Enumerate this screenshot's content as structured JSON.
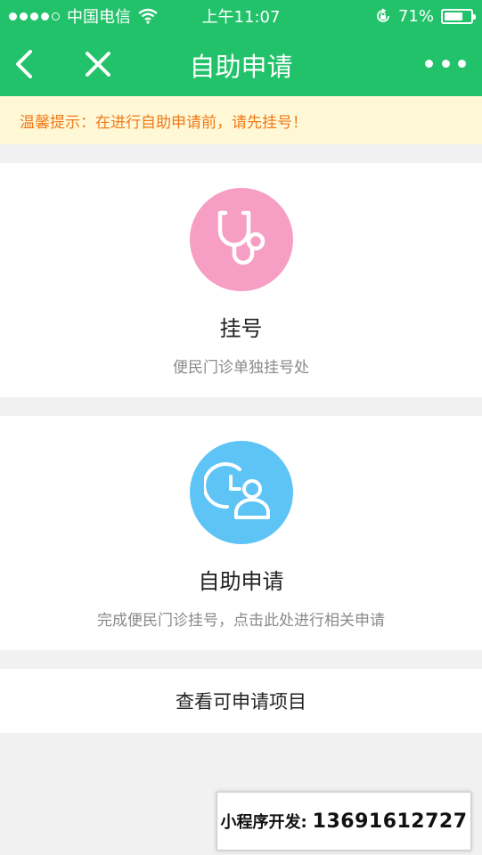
{
  "status_bar": {
    "carrier": "中国电信",
    "time": "上午11:07",
    "battery_percent": "71%",
    "battery_level": 0.71
  },
  "nav": {
    "title": "自助申请",
    "back_icon": "chevron-left-icon",
    "close_icon": "close-icon",
    "more_icon": "more-icon"
  },
  "notice": {
    "text": "温馨提示：在进行自助申请前，请先挂号！"
  },
  "cards": [
    {
      "title": "挂号",
      "subtitle": "便民门诊单独挂号处",
      "icon": "stethoscope-icon",
      "color": "#f79ec4"
    },
    {
      "title": "自助申请",
      "subtitle": "完成便民门诊挂号，点击此处进行相关申请",
      "icon": "clock-user-icon",
      "color": "#5ec4f5"
    }
  ],
  "view_items": {
    "label": "查看可申请项目"
  },
  "dev_banner": {
    "label": "小程序开发:",
    "phone": "13691612727"
  },
  "colors": {
    "primary": "#22c26a",
    "notice_bg": "#fff8d6",
    "notice_text": "#f07a1a"
  }
}
